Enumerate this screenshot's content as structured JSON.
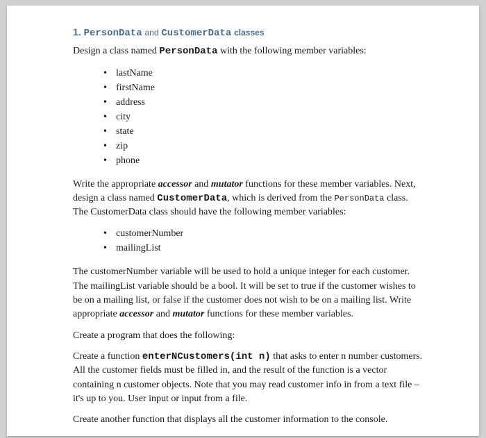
{
  "heading": {
    "num": "1.",
    "class1": "PersonData",
    "and": "and",
    "class2": "CustomerData",
    "tail": "classes"
  },
  "p1": {
    "pre": "Design a class named ",
    "code": "PersonData",
    "post": " with the following member variables:"
  },
  "list1": [
    "lastName",
    "firstName",
    "address",
    "city",
    "state",
    "zip",
    "phone"
  ],
  "p2": {
    "t1": "Write the appropriate ",
    "accessor": "accessor",
    "t2": " and ",
    "mutator": "mutator",
    "t3": " functions for these member variables. Next, design a class named ",
    "code1": "CustomerData",
    "t4": ", which is derived from the ",
    "code2": "PersonData",
    "t5": " class. The CustomerData class should have the following member variables:"
  },
  "list2": [
    "customerNumber",
    "mailingList"
  ],
  "p3": {
    "t1": "The customerNumber variable will be used to hold a unique integer for each customer. The mailingList variable should be a bool. It will be set to true if the customer wishes to be on a mailing list, or false if the customer does not wish to be on a mailing list. Write appropriate ",
    "accessor": "accessor",
    "t2": " and ",
    "mutator": "mutator",
    "t3": " functions for these member variables."
  },
  "p4": "Create a program that does the following:",
  "p5": {
    "t1": "Create a function ",
    "code": "enterNCustomers(int n)",
    "t2": "  that asks to enter n number customers.  All the customer fields must be filled in, and the result of the function is a vector containing n customer objects.  Note that you may read customer info in from a text file – it's up to you.  User input or input from a file."
  },
  "p6": "Create another function that displays all the customer information to the console."
}
